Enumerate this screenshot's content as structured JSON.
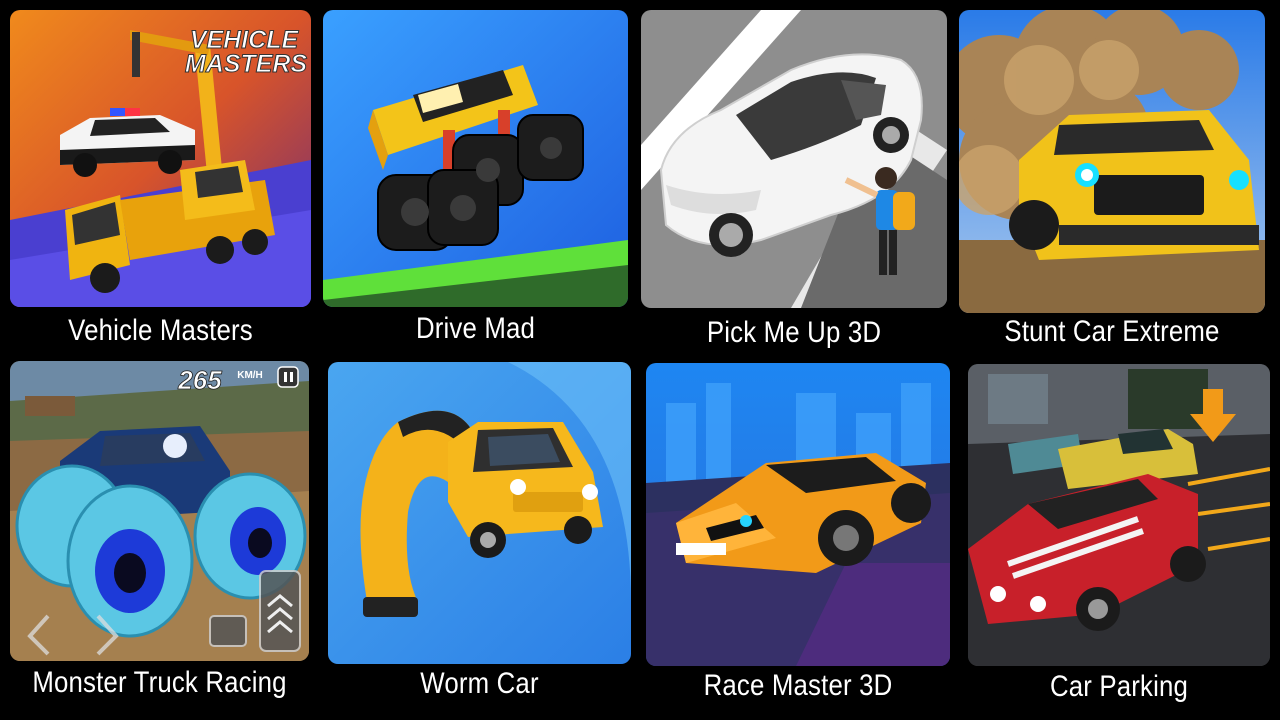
{
  "games": [
    {
      "title": "Vehicle Masters",
      "logo_text": [
        "VEHICLE",
        "MASTERS"
      ],
      "thumbnail": "crane-truck-lifting-police-car"
    },
    {
      "title": "Drive Mad",
      "thumbnail": "pixel-monster-truck-jumping"
    },
    {
      "title": "Pick Me Up 3D",
      "thumbnail": "white-sedan-and-waving-passenger"
    },
    {
      "title": "Stunt Car Extreme",
      "thumbnail": "yellow-muscle-car-in-dust"
    },
    {
      "title": "Monster Truck Racing",
      "hud": {
        "speed": "265",
        "unit": "KM/H"
      },
      "thumbnail": "blue-monster-truck"
    },
    {
      "title": "Worm Car",
      "thumbnail": "stretchy-yellow-car"
    },
    {
      "title": "Race Master 3D",
      "thumbnail": "orange-sports-car"
    },
    {
      "title": "Car Parking",
      "thumbnail": "red-muscle-car-in-parking-lot"
    }
  ],
  "colors": {
    "background": "#000000",
    "label": "#ffffff"
  }
}
